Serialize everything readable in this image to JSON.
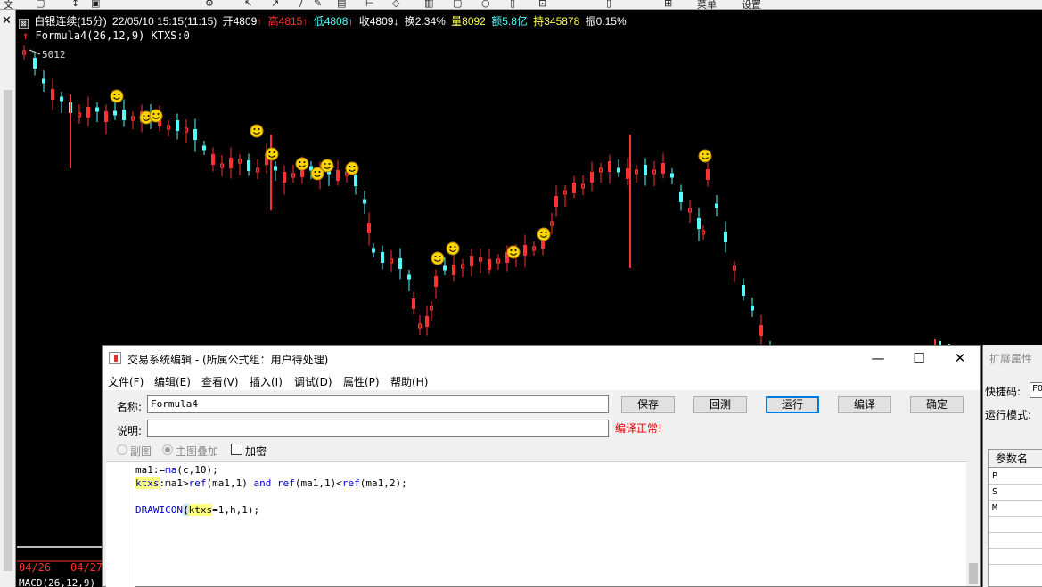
{
  "toolbar": {
    "items": [
      "文",
      "▢",
      "↕",
      "▣",
      "⚙",
      "↖",
      "↗",
      "/",
      "✎",
      "▤",
      "⊢",
      "◇",
      "▥",
      "▢",
      "○",
      "▯",
      "⊡",
      "▯",
      "⊞",
      "菜单",
      "设置"
    ]
  },
  "chart": {
    "symbol": "白银连续(15分)",
    "datetime": "22/05/10 15:15(11:15)",
    "open": "开4809",
    "high": "高4815",
    "low": "低4808",
    "close": "收4809",
    "turnover": "换2.34%",
    "volume": "量8092",
    "amount": "额5.8亿",
    "holding": "持345878",
    "amplitude": "振0.15%",
    "formula": "Formula4(26,12,9) KTXS:0",
    "peak_label": "5012",
    "dates": [
      "04/26",
      "04/27"
    ],
    "macd": "MACD(26,12,9)",
    "colors": {
      "up": "#ff3232",
      "down": "#54fcfc",
      "header_red": "#ff3030",
      "header_cyan": "#54fcfc",
      "header_yellow": "#ffff54"
    }
  },
  "editor": {
    "title": "交易系统编辑 - (所属公式组：用户待处理)",
    "menus": [
      "文件(F)",
      "编辑(E)",
      "查看(V)",
      "插入(I)",
      "调试(D)",
      "属性(P)",
      "帮助(H)"
    ],
    "name_label": "名称:",
    "name_value": "Formula4",
    "desc_label": "说明:",
    "desc_value": "",
    "buttons": {
      "save": "保存",
      "reply": "回测",
      "run": "运行",
      "compile": "编译",
      "ok": "确定"
    },
    "status": "编译正常!",
    "opt_sub": "副图",
    "opt_main": "主图叠加",
    "opt_encrypt": "加密",
    "code": {
      "l1_a": "ma1:=",
      "l1_fn": "ma",
      "l1_b": "(c,10);",
      "l2_var": "ktxs",
      "l2_a": ":ma1>",
      "l2_fn1": "ref",
      "l2_b": "(ma1,1) ",
      "l2_and": "and",
      "l2_sp": " ",
      "l2_fn2": "ref",
      "l2_c": "(ma1,1)<",
      "l2_fn3": "ref",
      "l2_d": "(ma1,2);",
      "l4_fn": "DRAWICON",
      "l4_paren": "(",
      "l4_var": "ktxs",
      "l4_rest": "=1,h,1);"
    }
  },
  "right_panel": {
    "title": "扩展属性",
    "shortcut_label": "快捷码:",
    "shortcut_value": "FO",
    "mode_label": "运行模式:",
    "param_header": "参数名",
    "params": [
      "P",
      "S",
      "M"
    ]
  }
}
